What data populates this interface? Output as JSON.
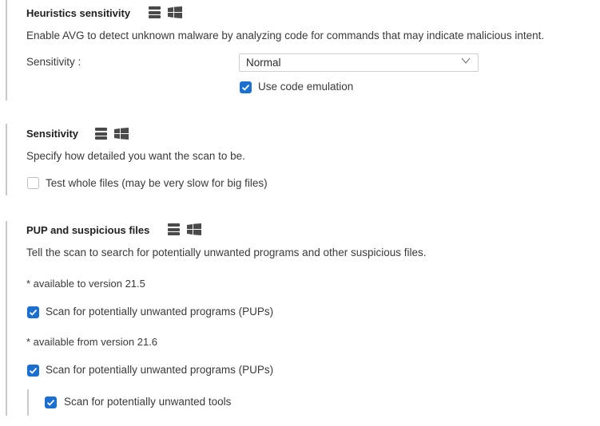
{
  "heuristics": {
    "title": "Heuristics sensitivity",
    "description": "Enable AVG to detect unknown malware by analyzing code for commands that may indicate malicious intent.",
    "sensitivity_label": "Sensitivity :",
    "sensitivity_value": "Normal",
    "code_emulation_label": "Use code emulation",
    "code_emulation_checked": true
  },
  "sensitivity": {
    "title": "Sensitivity",
    "description": "Specify how detailed you want the scan to be.",
    "test_whole_files_label": "Test whole files (may be very slow for big files)",
    "test_whole_files_checked": false
  },
  "pup": {
    "title": "PUP and suspicious files",
    "description": "Tell the scan to search for potentially unwanted programs and other suspicious files.",
    "note_to_21_5": "* available to version 21.5",
    "scan_pups_label_1": "Scan for potentially unwanted programs (PUPs)",
    "note_from_21_6": "* available from version 21.6",
    "scan_pups_label_2": "Scan for potentially unwanted programs (PUPs)",
    "scan_tools_label": "Scan for potentially unwanted tools"
  },
  "icons": {
    "server": "server-icon",
    "windows": "windows-icon"
  },
  "colors": {
    "accent": "#1a6fd1",
    "divider": "#c9c9c9"
  }
}
